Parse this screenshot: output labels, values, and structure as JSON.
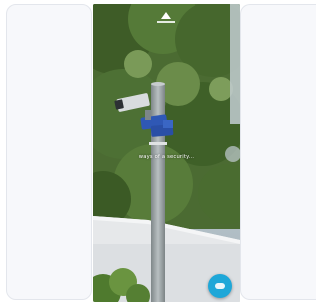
{
  "gallery": {
    "caption": "ways of a security..."
  },
  "colors": {
    "sky": "#b9c7cf",
    "foliage": "#3f5f2a",
    "pole": "#9ca3a6",
    "chat_accent": "#1ea7d8"
  },
  "icons": {
    "logo": "home-logo-icon",
    "camera": "cctv-camera-icon",
    "chat": "chat-bubble-icon"
  }
}
